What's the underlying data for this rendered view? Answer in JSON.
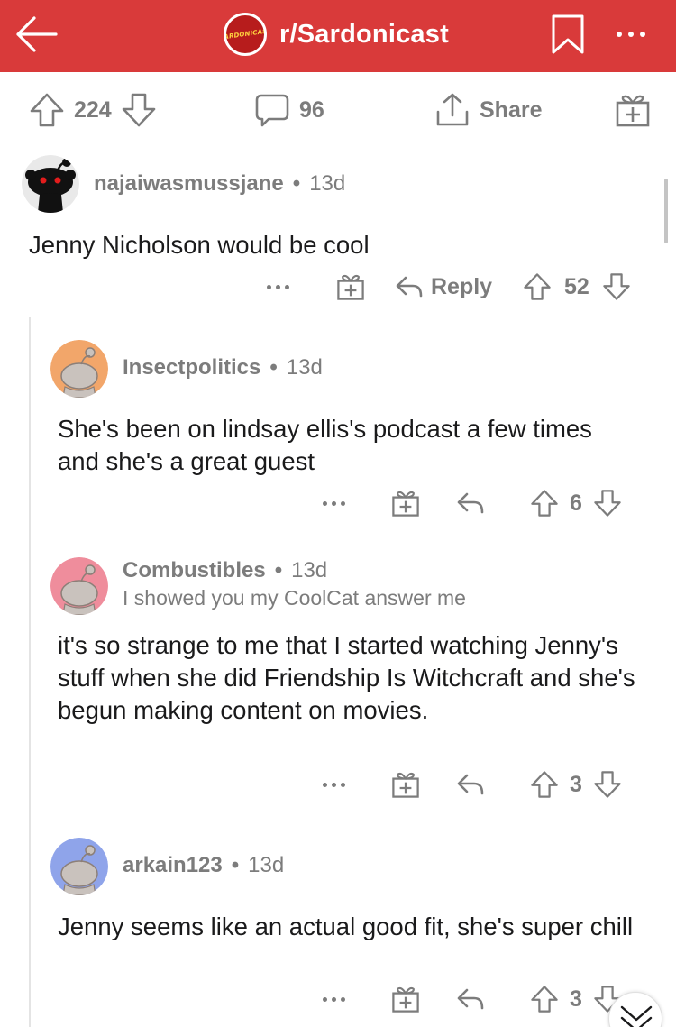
{
  "header": {
    "subreddit": "r/Sardonicast",
    "logo_text": "SARDONICAST",
    "accent_color": "#d93a3a",
    "icons": [
      "back-arrow-icon",
      "bookmark-icon",
      "more-icon"
    ]
  },
  "post_actions": {
    "upvotes": "224",
    "comments": "96",
    "share_label": "Share",
    "icons": [
      "upvote-icon",
      "downvote-icon",
      "comment-icon",
      "share-icon",
      "award-icon"
    ]
  },
  "comments": [
    {
      "username": "najaiwasmussjane",
      "age": "13d",
      "text": "Jenny Nicholson would be cool",
      "reply_label": "Reply",
      "score": "52",
      "avatar": "black-snoo-avatar"
    },
    {
      "username": "Insectpolitics",
      "age": "13d",
      "text": "She's been on lindsay ellis's podcast a few times and she's a great guest",
      "score": "6",
      "avatar_color": "#f2a66a"
    },
    {
      "username": "Combustibles",
      "age": "13d",
      "flair": "I showed you my CoolCat answer me",
      "text": "it's so strange to me that I started watching Jenny's stuff when she did Friendship Is Witchcraft and she's begun making content on movies.",
      "score": "3",
      "avatar_color": "#ef8d9c"
    },
    {
      "username": "arkain123",
      "age": "13d",
      "text": "Jenny seems like an actual good fit, she's super chill",
      "score": "3",
      "avatar_color": "#8fa4ea"
    }
  ],
  "dot_separator": "•"
}
